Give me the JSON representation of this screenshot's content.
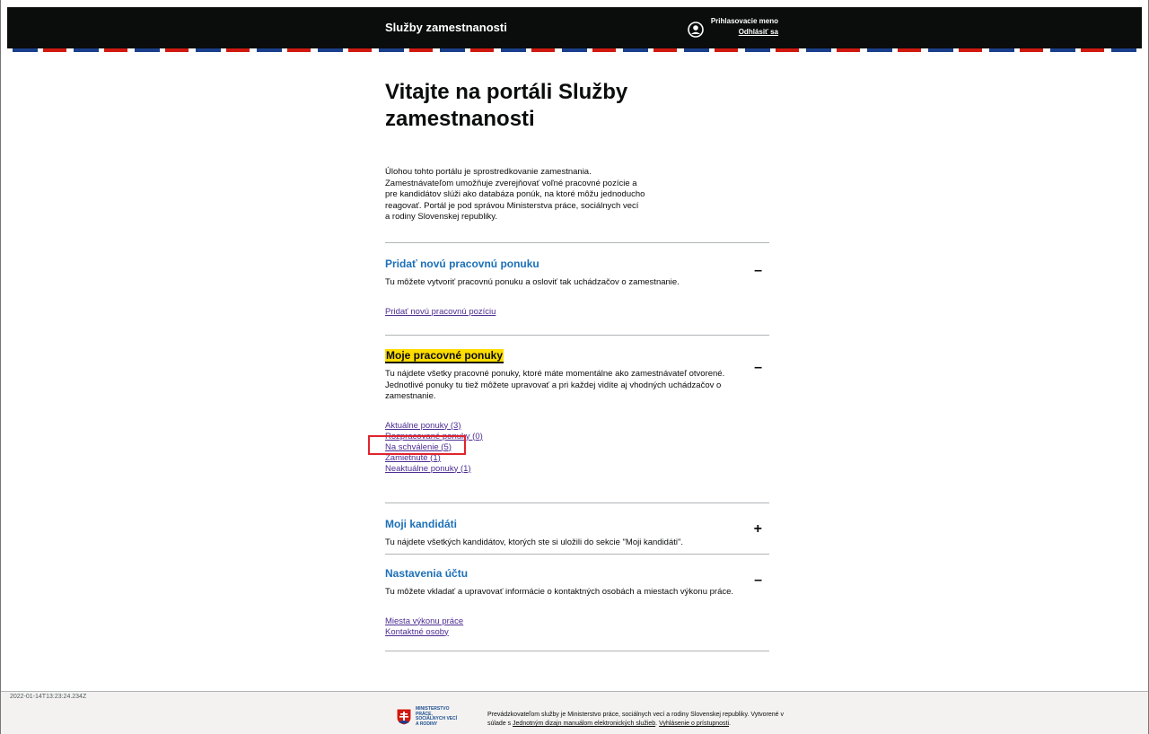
{
  "header": {
    "brand": "Služby zamestnanosti",
    "user_name": "Prihlasovacie meno",
    "logout": "Odhlásiť sa"
  },
  "main": {
    "title": "Vitajte na portáli Služby zamestnanosti",
    "intro": "Úlohou tohto portálu je sprostredkovanie zamestnania. Zamestnávateľom umožňuje zverejňovať voľné pracovné pozície a pre kandidátov slúži ako databáza ponúk, na ktoré môžu jednoducho reagovať. Portál je pod správou Ministerstva práce, sociálnych vecí a rodiny Slovenskej republiky."
  },
  "sections": [
    {
      "title": "Pridať novú pracovnú ponuku",
      "desc": "Tu môžete vytvoriť pracovnú ponuku a osloviť tak uchádzačov o zamestnanie.",
      "toggle": "–",
      "links": [
        "Pridať novú pracovnú pozíciu"
      ]
    },
    {
      "title": "Moje pracovné ponuky",
      "desc": "Tu nájdete všetky pracovné ponuky, ktoré máte momentálne ako zamestnávateľ otvorené. Jednotlivé ponuky tu tiež môžete upravovať a pri každej vidíte aj vhodných uchádzačov o zamestnanie.",
      "toggle": "–",
      "links": [
        "Aktuálne ponuky (3)",
        "Rozpracované ponuky (0)",
        "Na schválenie (5)",
        "Zamietnuté (1)",
        "Neaktuálne ponuky (1)"
      ]
    },
    {
      "title": "Moji kandidáti",
      "desc": "Tu nájdete všetkých kandidátov, ktorých ste si uložili do sekcie \"Moji kandidáti\".",
      "toggle": "+"
    },
    {
      "title": "Nastavenia účtu",
      "desc": "Tu môžete vkladať a upravovať informácie o kontaktných osobách a miestach výkonu práce.",
      "toggle": "–",
      "links": [
        "Miesta výkonu práce",
        "Kontaktné osoby"
      ]
    }
  ],
  "footer": {
    "timestamp": "2022-01-14T13:23:24.234Z",
    "ministry_name": "MINISTERSTVO PRÁCE, SOCIÁLNYCH VECÍ A RODINY",
    "text_prefix": "Prevádzkovateľom služby je Ministerstvo práce, sociálnych vecí a rodiny Slovenskej republiky. Vytvorené v súlade s ",
    "link_manual": "Jednotným dizajn manuálom elektronických služieb",
    "text_sep": ". ",
    "link_accessibility": "Vyhlásenie o prístupnosti",
    "text_end": "."
  },
  "colors": {
    "header_bg": "#0b0c0c",
    "link": "#1d70b8",
    "visited_link": "#4c2c92",
    "focus": "#ffdd00",
    "annotation": "#e0242e"
  }
}
